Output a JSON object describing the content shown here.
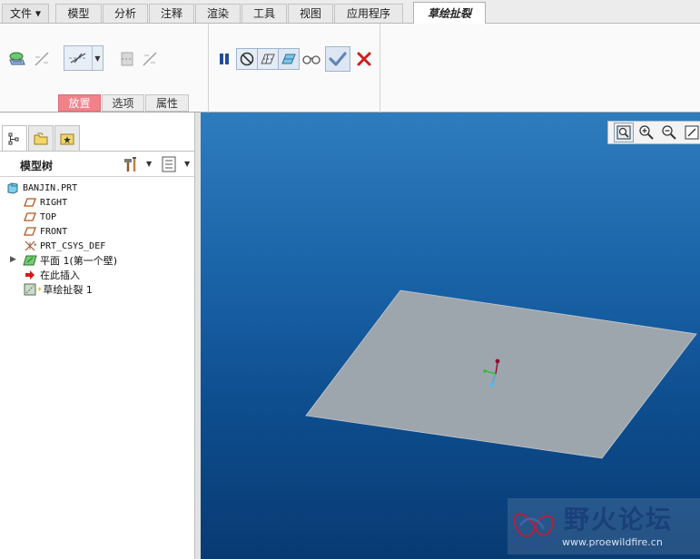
{
  "menu": {
    "file_label": "文件",
    "tabs": [
      "模型",
      "分析",
      "注释",
      "渲染",
      "工具",
      "视图",
      "应用程序"
    ],
    "active_tab": "草绘扯裂"
  },
  "ribbon": {
    "subtabs": {
      "placement": "放置",
      "options": "选项",
      "properties": "属性"
    }
  },
  "left_panel": {
    "tree_title": "模型树",
    "tree_items": [
      {
        "label": "BANJIN.PRT",
        "icon": "part-icon"
      },
      {
        "label": "RIGHT",
        "icon": "datum-plane-icon"
      },
      {
        "label": "TOP",
        "icon": "datum-plane-icon"
      },
      {
        "label": "FRONT",
        "icon": "datum-plane-icon"
      },
      {
        "label": "PRT_CSYS_DEF",
        "icon": "csys-icon"
      },
      {
        "label": "平面 1(第一个壁)",
        "icon": "planar-wall-icon",
        "expandable": true
      },
      {
        "label": "在此插入",
        "icon": "insert-here-arrow-icon"
      },
      {
        "label": "草绘扯裂 1",
        "icon": "sketched-rip-icon"
      }
    ]
  },
  "viewport": {
    "watermark_name": "野火论坛",
    "watermark_url": "www.proewildfire.cn"
  },
  "colors": {
    "accent_subtab": "#f0828a",
    "viewport_top": "#2f7cbd",
    "viewport_bottom": "#083a72",
    "plate": "#9ea6ad",
    "ok_check": "#5f86b6",
    "cancel_x": "#cc1f1f"
  }
}
